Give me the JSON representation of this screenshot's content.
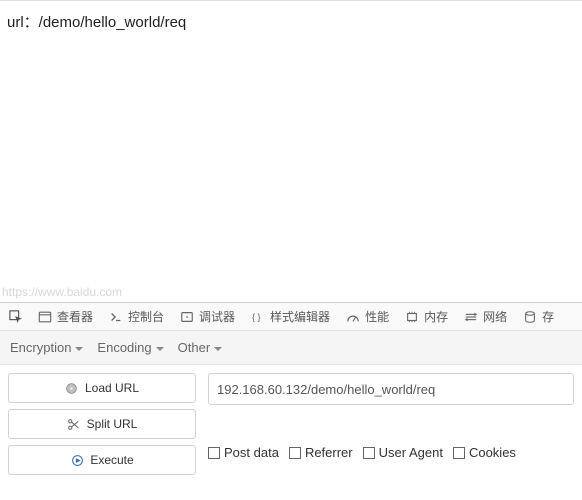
{
  "page": {
    "url_text": "url：/demo/hello_world/req",
    "watermark": "https://www.baidu.com"
  },
  "devtools": {
    "tabs": {
      "inspector": "查看器",
      "console": "控制台",
      "debugger": "调试器",
      "style": "样式编辑器",
      "performance": "性能",
      "memory": "内存",
      "network": "网络",
      "storage": "存"
    }
  },
  "subtoolbar": {
    "encryption": "Encryption",
    "encoding": "Encoding",
    "other": "Other"
  },
  "hackbar": {
    "buttons": {
      "load": "Load URL",
      "split": "Split URL",
      "execute": "Execute"
    },
    "url_value": "192.168.60.132/demo/hello_world/req",
    "checks": {
      "postdata": "Post data",
      "referrer": "Referrer",
      "useragent": "User Agent",
      "cookies": "Cookies"
    }
  }
}
